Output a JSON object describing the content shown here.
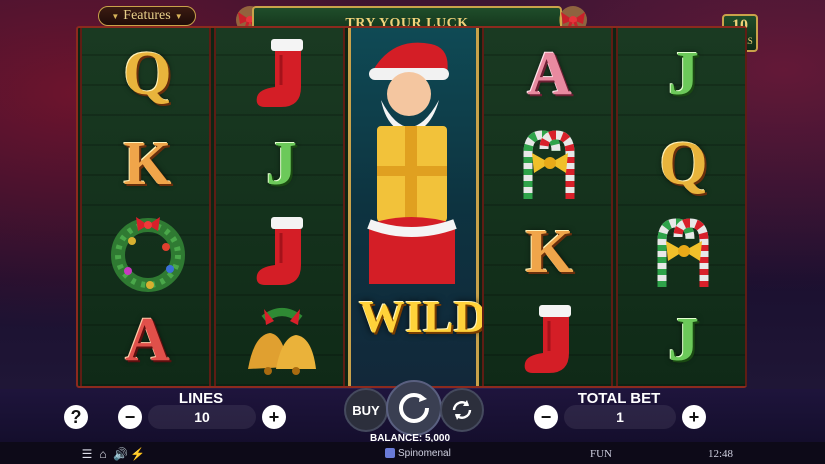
{
  "header": {
    "features_label": "Features",
    "banner_text": "TRY YOUR LUCK",
    "lines_badge": {
      "number": "10",
      "label": "LINES"
    }
  },
  "reels": [
    [
      "Q",
      "K",
      "wreath",
      "A"
    ],
    [
      "stocking",
      "J",
      "stocking",
      "bells"
    ],
    [
      "santa-wild",
      "santa-wild",
      "santa-wild",
      "santa-wild"
    ],
    [
      "A",
      "candy-cane",
      "K",
      "stocking"
    ],
    [
      "J",
      "Q",
      "candy-cane",
      "J"
    ]
  ],
  "wild_label": "WILD",
  "controls": {
    "help_label": "?",
    "lines_label": "LINES",
    "lines_value": "10",
    "minus": "−",
    "plus": "+",
    "buy_label": "BUY",
    "total_bet_label": "TOTAL BET",
    "total_bet_value": "1",
    "balance": "BALANCE: 5,000"
  },
  "footer": {
    "brand": "Spinomenal",
    "mode": "FUN",
    "time": "12:48"
  },
  "colors": {
    "gold": "#c9a24a",
    "reel_green": "#0f2a17",
    "wild_teal": "#0d3340",
    "panel": "#1e143c"
  }
}
